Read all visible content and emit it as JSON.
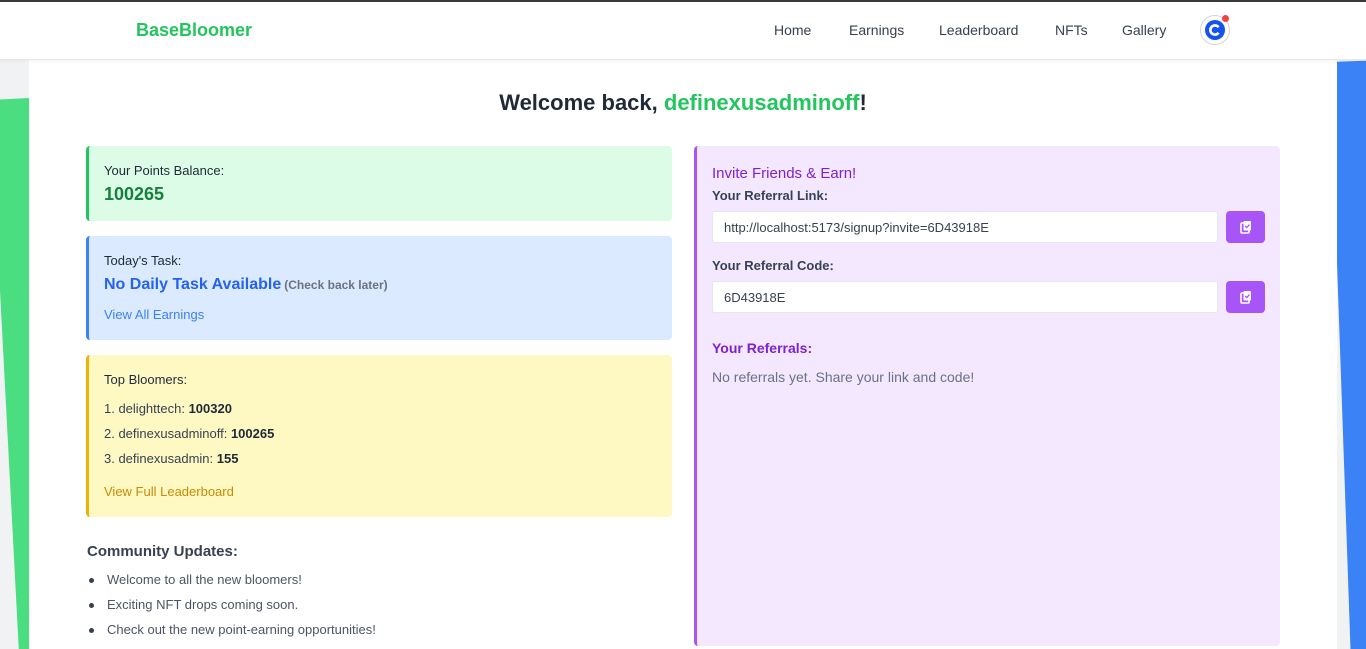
{
  "nav": {
    "brand": "BaseBloomer",
    "links": [
      "Home",
      "Earnings",
      "Leaderboard",
      "NFTs",
      "Gallery"
    ],
    "avatar_icon": "coinbase-c-icon",
    "notification_color": "#ef4444"
  },
  "welcome": {
    "prefix": "Welcome back, ",
    "username": "definexusadminoff",
    "suffix": "!"
  },
  "points": {
    "label": "Your Points Balance:",
    "value": "100265"
  },
  "task": {
    "label": "Today's Task:",
    "title": "No Daily Task Available",
    "hint": "(Check back later)",
    "link": "View All Earnings"
  },
  "top_bloomers": {
    "label": "Top Bloomers:",
    "entries": [
      {
        "prefix": "1. delighttech: ",
        "points": "100320"
      },
      {
        "prefix": "2. definexusadminoff: ",
        "points": "100265"
      },
      {
        "prefix": "3. definexusadmin: ",
        "points": "155"
      }
    ],
    "link": "View Full Leaderboard"
  },
  "community": {
    "title": "Community Updates:",
    "items": [
      "Welcome to all the new bloomers!",
      "Exciting NFT drops coming soon.",
      "Check out the new point-earning opportunities!"
    ]
  },
  "invite": {
    "title": "Invite Friends & Earn!",
    "link_label": "Your Referral Link:",
    "link_value": "http://localhost:5173/signup?invite=6D43918E",
    "code_label": "Your Referral Code:",
    "code_value": "6D43918E",
    "referrals_title": "Your Referrals:",
    "referrals_empty": "No referrals yet. Share your link and code!",
    "copy_icon": "clipboard-copy-icon"
  },
  "colors": {
    "brand_green": "#22c55e",
    "blue": "#3b82f6",
    "yellow": "#eab308",
    "purple": "#a855f7"
  }
}
